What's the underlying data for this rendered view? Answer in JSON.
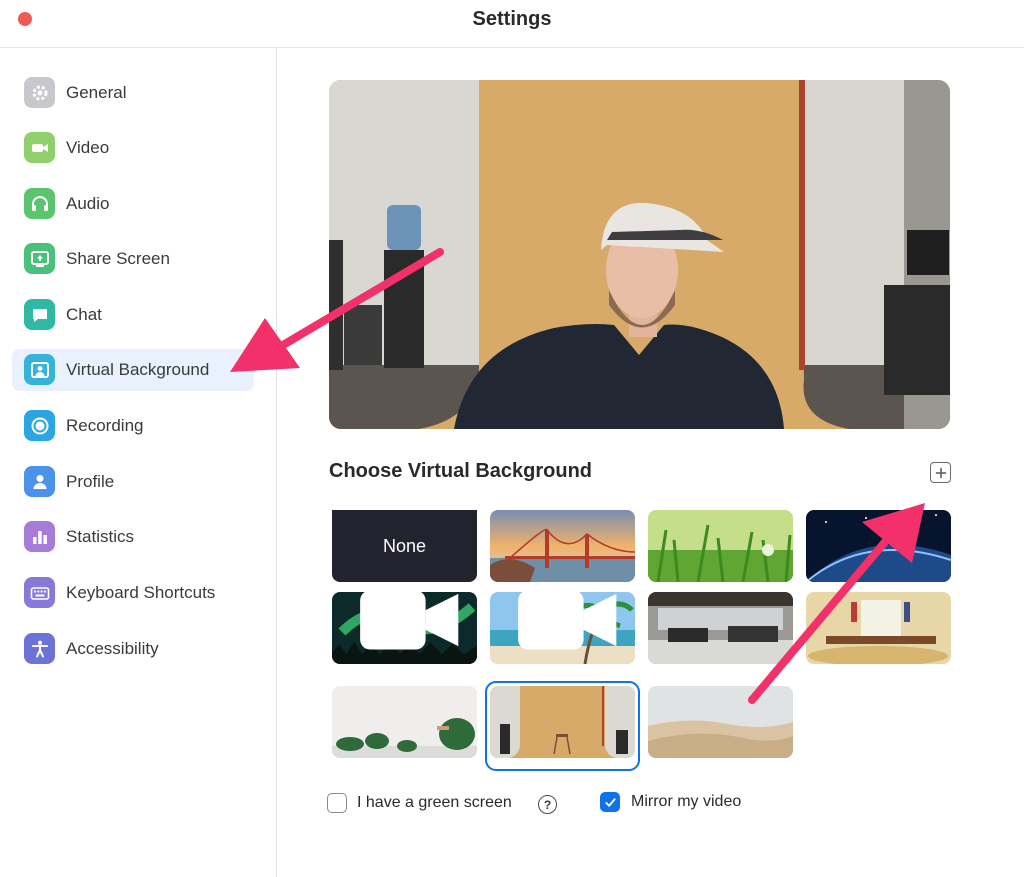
{
  "window": {
    "title": "Settings"
  },
  "sidebar": {
    "items": [
      {
        "label": "General",
        "icon": "gear-icon",
        "color": "#c7c7cc"
      },
      {
        "label": "Video",
        "icon": "video-camera-icon",
        "color": "#8fd06c"
      },
      {
        "label": "Audio",
        "icon": "headphones-icon",
        "color": "#5cc46e"
      },
      {
        "label": "Share Screen",
        "icon": "share-screen-icon",
        "color": "#4bc07a"
      },
      {
        "label": "Chat",
        "icon": "chat-bubble-icon",
        "color": "#2fb8a4"
      },
      {
        "label": "Virtual Background",
        "icon": "person-frame-icon",
        "color": "#35b3d8",
        "active": true
      },
      {
        "label": "Recording",
        "icon": "record-icon",
        "color": "#2ba6e0"
      },
      {
        "label": "Profile",
        "icon": "person-icon",
        "color": "#4b93e8"
      },
      {
        "label": "Statistics",
        "icon": "bar-chart-icon",
        "color": "#a77bd8"
      },
      {
        "label": "Keyboard Shortcuts",
        "icon": "keyboard-icon",
        "color": "#8878d8"
      },
      {
        "label": "Accessibility",
        "icon": "accessibility-icon",
        "color": "#6b74d6"
      }
    ]
  },
  "main": {
    "section_title": "Choose Virtual Background",
    "add_icon": "plus-icon",
    "backgrounds": [
      {
        "label": "None"
      },
      {
        "scene": "golden-gate-bridge"
      },
      {
        "scene": "green-grass"
      },
      {
        "scene": "earth-from-space"
      },
      {
        "scene": "northern-lights",
        "video": true
      },
      {
        "scene": "palm-beach",
        "video": true
      },
      {
        "scene": "office"
      },
      {
        "scene": "oval-office"
      },
      {
        "scene": "plants-room"
      },
      {
        "scene": "tan-backdrop-studio",
        "selected": true
      },
      {
        "scene": "desert-dunes"
      }
    ],
    "green_screen_label": "I have a green screen",
    "green_screen_checked": false,
    "help_glyph": "?",
    "mirror_label": "Mirror my video",
    "mirror_checked": true
  },
  "colors": {
    "accent": "#0e72ed",
    "annotation_arrow": "#f2306a",
    "close_button": "#ee5b57"
  }
}
